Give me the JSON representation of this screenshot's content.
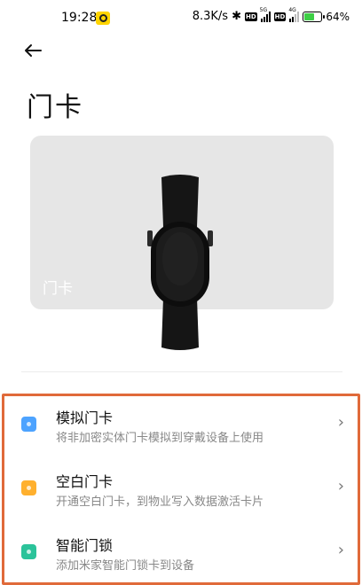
{
  "status_bar": {
    "time": "19:28",
    "speed": "8.3K/s",
    "battery_level": "64%",
    "icons": [
      "notification-o-icon",
      "bluetooth-icon",
      "hd-icon",
      "5g-signal-icon",
      "hd-icon",
      "4g-signal-icon",
      "battery-charging-icon"
    ]
  },
  "header": {
    "back_icon": "back-arrow-icon",
    "title": "门卡"
  },
  "card": {
    "label": "门卡",
    "device_image": "smart-band-image"
  },
  "options": [
    {
      "icon": "simulate-card-icon",
      "icon_color": "#4da3ff",
      "title": "模拟门卡",
      "description": "将非加密实体门卡模拟到穿戴设备上使用"
    },
    {
      "icon": "blank-card-icon",
      "icon_color": "#ffb02e",
      "title": "空白门卡",
      "description": "开通空白门卡，到物业写入数据激活卡片"
    },
    {
      "icon": "smart-lock-icon",
      "icon_color": "#2bc39a",
      "title": "智能门锁",
      "description": "添加米家智能门锁卡到设备"
    }
  ],
  "colors": {
    "highlight_border": "#e06a3a",
    "card_background": "#e6e6e6"
  }
}
